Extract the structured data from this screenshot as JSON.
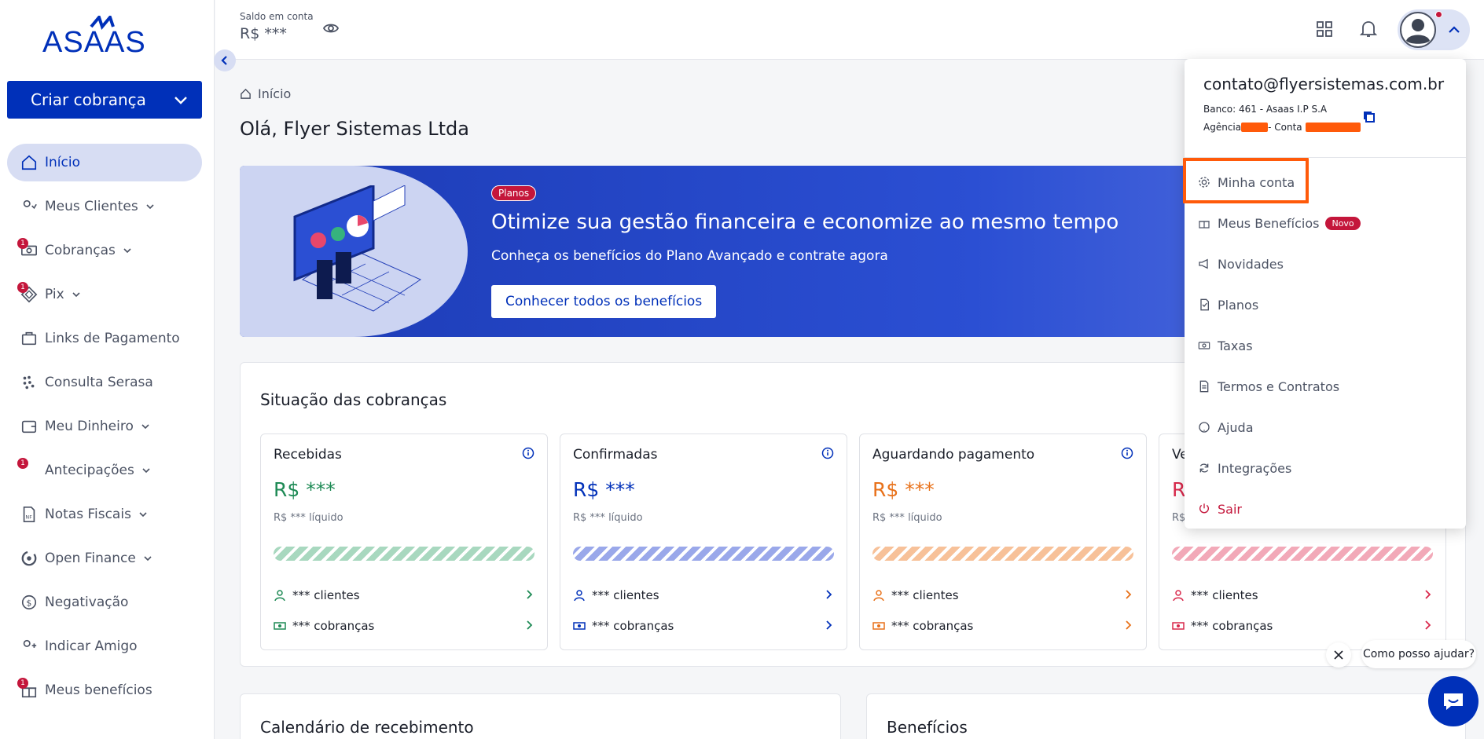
{
  "brand": {
    "logo_text": "ASAAS",
    "primary_color": "#0030b9",
    "accent_red": "#c4163b"
  },
  "sidebar": {
    "create_button": "Criar cobrança",
    "items": [
      {
        "label": "Início",
        "icon": "home-icon",
        "active": true,
        "badge": "",
        "caret": false
      },
      {
        "label": "Meus Clientes",
        "icon": "users-icon",
        "badge": "",
        "caret": true
      },
      {
        "label": "Cobranças",
        "icon": "money-icon",
        "badge": "1",
        "caret": true
      },
      {
        "label": "Pix",
        "icon": "pix-icon",
        "badge": "1",
        "caret": true
      },
      {
        "label": "Links de Pagamento",
        "icon": "briefcase-icon",
        "badge": "",
        "caret": false
      },
      {
        "label": "Consulta Serasa",
        "icon": "serasa-icon",
        "badge": "",
        "caret": false
      },
      {
        "label": "Meu Dinheiro",
        "icon": "wallet-icon",
        "badge": "",
        "caret": true
      },
      {
        "label": "Antecipações",
        "icon": "dollar-icon",
        "badge": "1",
        "caret": true
      },
      {
        "label": "Notas Fiscais",
        "icon": "invoice-icon",
        "badge": "",
        "caret": true
      },
      {
        "label": "Open Finance",
        "icon": "open-finance-icon",
        "badge": "",
        "caret": true
      },
      {
        "label": "Negativação",
        "icon": "negativacao-icon",
        "badge": "",
        "caret": false
      },
      {
        "label": "Indicar Amigo",
        "icon": "user-plus-icon",
        "badge": "",
        "caret": false
      },
      {
        "label": "Meus benefícios",
        "icon": "gift-icon",
        "badge": "1",
        "caret": false
      }
    ]
  },
  "topbar": {
    "saldo_label": "Saldo em conta",
    "saldo_value": "R$ ***"
  },
  "main": {
    "breadcrumb": "Início",
    "greeting": "Olá, Flyer Sistemas Ltda",
    "banner": {
      "pill": "Planos",
      "title": "Otimize sua gestão financeira e economize ao mesmo tempo",
      "subtitle": "Conheça os benefícios do Plano Avançado e contrate agora",
      "button": "Conhecer todos os benefícios"
    },
    "status_panel": {
      "title": "Situação das cobranças",
      "cards": [
        {
          "title": "Recebidas",
          "amount": "R$ ***",
          "net": "R$ *** líquido",
          "clients": "*** clientes",
          "charges": "*** cobranças",
          "color": "#1e8a55",
          "bar_color": "#a8d8bf"
        },
        {
          "title": "Confirmadas",
          "amount": "R$ ***",
          "net": "R$ *** líquido",
          "clients": "*** clientes",
          "charges": "*** cobranças",
          "color": "#0030b9",
          "bar_color": "#9aa8ea"
        },
        {
          "title": "Aguardando pagamento",
          "amount": "R$ ***",
          "net": "R$ *** líquido",
          "clients": "*** clientes",
          "charges": "*** cobranças",
          "color": "#e8711a",
          "bar_color": "#f7c199"
        },
        {
          "title": "Ve",
          "amount": "R",
          "net": "R$",
          "clients": "*** clientes",
          "charges": "*** cobranças",
          "color": "#d9284b",
          "bar_color": "#f2a9b8"
        }
      ]
    },
    "calendar_title": "Calendário de recebimento",
    "benefits_title": "Benefícios"
  },
  "dropdown": {
    "email": "contato@flyersistemas.com.br",
    "bank": "Banco: 461 - Asaas I.P S.A",
    "agency_label": "Agência",
    "account_label": "- Conta",
    "items": [
      {
        "label": "Minha conta",
        "icon": "gear-icon"
      },
      {
        "label": "Meus Benefícios",
        "icon": "gift-icon",
        "badge": "Novo"
      },
      {
        "label": "Novidades",
        "icon": "megaphone-icon"
      },
      {
        "label": "Planos",
        "icon": "plans-icon"
      },
      {
        "label": "Taxas",
        "icon": "money-icon"
      },
      {
        "label": "Termos e Contratos",
        "icon": "document-icon"
      },
      {
        "label": "Ajuda",
        "icon": "help-icon"
      },
      {
        "label": "Integrações",
        "icon": "refresh-icon"
      },
      {
        "label": "Sair",
        "icon": "power-icon"
      }
    ]
  },
  "chat": {
    "bubble": "Como posso ajudar?"
  }
}
